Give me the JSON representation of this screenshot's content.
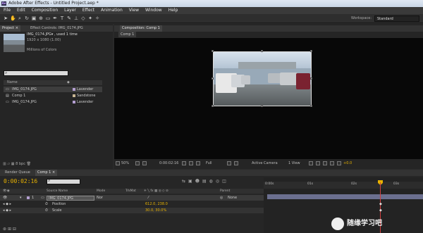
{
  "window": {
    "title": "Adobe After Effects - Untitled Project.aep *",
    "app_icon": "Ae"
  },
  "menu": [
    "File",
    "Edit",
    "Composition",
    "Layer",
    "Effect",
    "Animation",
    "View",
    "Window",
    "Help"
  ],
  "toolbar": {
    "workspace_label": "Workspace:",
    "workspace_value": "Standard"
  },
  "project_panel": {
    "tabs": [
      "Project ×",
      "Effect Controls: IMG_0174.JPG"
    ],
    "selected_name": "IMG_0174.JPG▾ , used 1 time",
    "selected_dims": "1920 x 1080 (1.00)",
    "selected_colors": "Millions of Colors",
    "search_placeholder": "",
    "column_name": "Name",
    "items": [
      {
        "name": "IMG_0174.JPG",
        "label": "Lavender",
        "color": "#b49fd1",
        "selected": true
      },
      {
        "name": "Comp 1",
        "label": "Sandstone",
        "color": "#c7b592",
        "selected": false
      },
      {
        "name": "IMG_0174.JPG",
        "label": "Lavender",
        "color": "#b49fd1",
        "selected": false
      }
    ],
    "bpc": "8 bpc"
  },
  "comp_panel": {
    "tab": "Composition: Comp 1",
    "sub_tab": "Comp 1",
    "zoom": "50%",
    "timecode": "0:00:02:16",
    "resolution": "Full",
    "camera": "Active Camera",
    "view": "1 View",
    "exposure": "+0.0"
  },
  "timeline": {
    "tabs": [
      "Render Queue",
      "Comp 1 ×"
    ],
    "timecode": "0:00:02:16",
    "col_source": "Source Name",
    "col_mode": "Mode",
    "col_trkmat": "TrkMat",
    "col_parent": "Parent",
    "layers": [
      {
        "num": "1",
        "name": "IMG_0174.JPG",
        "mode": "Nor",
        "parent": "None"
      }
    ],
    "properties": [
      {
        "name": "Position",
        "value": "612.0, 238.0"
      },
      {
        "name": "Scale",
        "value": "30.0, 30.0%"
      }
    ],
    "ruler_ticks": [
      "0:00s",
      "01s",
      "02s",
      "03s"
    ]
  },
  "watermark": {
    "text": "随缘学习吧"
  },
  "colors": {
    "timecode": "#e8b200",
    "playhead": "#d04040",
    "layer_bar": "#6b6f8f"
  }
}
